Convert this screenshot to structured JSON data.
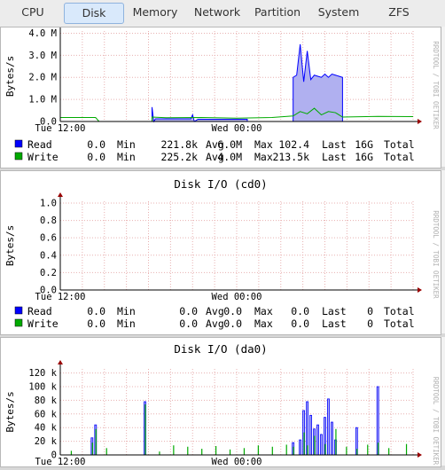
{
  "tabs": [
    {
      "label": "CPU",
      "active": false
    },
    {
      "label": "Disk",
      "active": true
    },
    {
      "label": "Memory",
      "active": false
    },
    {
      "label": "Network",
      "active": false
    },
    {
      "label": "Partition",
      "active": false
    },
    {
      "label": "System",
      "active": false
    },
    {
      "label": "ZFS",
      "active": false
    }
  ],
  "colors": {
    "read": "#0000ff",
    "read_fill": "#b0b0f0",
    "write": "#00aa00",
    "grid": "#e8b0b0",
    "axis": "#000000",
    "arrow": "#990000"
  },
  "watermark": "RRDTOOL / TOBI OETIKER",
  "charts": [
    {
      "title": "",
      "ylabel": "Bytes/s",
      "y_ticks": [
        {
          "v": 0,
          "label": "0.0"
        },
        {
          "v": 1000000,
          "label": "1.0 M"
        },
        {
          "v": 2000000,
          "label": "2.0 M"
        },
        {
          "v": 3000000,
          "label": "3.0 M"
        },
        {
          "v": 4000000,
          "label": "4.0 M"
        }
      ],
      "ymax": 4100000,
      "x_labels": [
        {
          "pos": 0.0,
          "label": "Tue 12:00"
        },
        {
          "pos": 0.5,
          "label": "Wed 00:00"
        }
      ],
      "legend": [
        {
          "name": "Read",
          "cur": "0.0",
          "min_label": "Min",
          "min": "221.8k",
          "avg_label": "Avg",
          "avg": "6.0M",
          "max_label": "Max",
          "max": "102.4",
          "last_label": "Last",
          "last": "16G",
          "total_label": "Total"
        },
        {
          "name": "Write",
          "cur": "0.0",
          "min_label": "Min",
          "min": "225.2k",
          "avg_label": "Avg",
          "avg": "4.0M",
          "max_label": "Max",
          "max": "213.5k",
          "last_label": "Last",
          "last": "16G",
          "total_label": "Total"
        }
      ]
    },
    {
      "title": "Disk I/O (cd0)",
      "ylabel": "Bytes/s",
      "y_ticks": [
        {
          "v": 0,
          "label": "0.0"
        },
        {
          "v": 0.2,
          "label": "0.2"
        },
        {
          "v": 0.4,
          "label": "0.4"
        },
        {
          "v": 0.6,
          "label": "0.6"
        },
        {
          "v": 0.8,
          "label": "0.8"
        },
        {
          "v": 1.0,
          "label": "1.0"
        }
      ],
      "ymax": 1.02,
      "x_labels": [
        {
          "pos": 0.0,
          "label": "Tue 12:00"
        },
        {
          "pos": 0.5,
          "label": "Wed 00:00"
        }
      ],
      "legend": [
        {
          "name": "Read",
          "cur": "0.0",
          "min_label": "Min",
          "min": "0.0",
          "avg_label": "Avg",
          "avg": "0.0",
          "max_label": "Max",
          "max": "0.0",
          "last_label": "Last",
          "last": "0",
          "total_label": "Total"
        },
        {
          "name": "Write",
          "cur": "0.0",
          "min_label": "Min",
          "min": "0.0",
          "avg_label": "Avg",
          "avg": "0.0",
          "max_label": "Max",
          "max": "0.0",
          "last_label": "Last",
          "last": "0",
          "total_label": "Total"
        }
      ]
    },
    {
      "title": "Disk I/O (da0)",
      "ylabel": "Bytes/s",
      "y_ticks": [
        {
          "v": 0,
          "label": "0"
        },
        {
          "v": 20000,
          "label": "20 k"
        },
        {
          "v": 40000,
          "label": "40 k"
        },
        {
          "v": 60000,
          "label": "60 k"
        },
        {
          "v": 80000,
          "label": "80 k"
        },
        {
          "v": 100000,
          "label": "100 k"
        },
        {
          "v": 120000,
          "label": "120 k"
        }
      ],
      "ymax": 126000,
      "x_labels": [
        {
          "pos": 0.0,
          "label": "Tue 12:00"
        },
        {
          "pos": 0.5,
          "label": "Wed 00:00"
        }
      ],
      "legend": []
    }
  ],
  "chart_data": [
    {
      "type": "area",
      "title": "",
      "ylabel": "Bytes/s",
      "ylim": [
        0,
        4100000
      ],
      "x_domain": [
        0,
        100
      ],
      "series": [
        {
          "name": "Read",
          "values": [
            [
              0,
              0
            ],
            [
              26,
              0
            ],
            [
              26,
              650000
            ],
            [
              26.5,
              0
            ],
            [
              27,
              120000
            ],
            [
              37,
              120000
            ],
            [
              37.5,
              300000
            ],
            [
              38,
              0
            ],
            [
              39,
              100000
            ],
            [
              53,
              100000
            ],
            [
              53,
              0
            ],
            [
              66,
              0
            ],
            [
              66,
              2000000
            ],
            [
              67,
              2100000
            ],
            [
              68,
              3500000
            ],
            [
              69,
              1800000
            ],
            [
              70,
              3200000
            ],
            [
              71,
              1900000
            ],
            [
              72,
              2100000
            ],
            [
              73,
              2050000
            ],
            [
              74,
              2000000
            ],
            [
              75,
              2150000
            ],
            [
              76,
              2000000
            ],
            [
              77,
              2150000
            ],
            [
              78,
              2100000
            ],
            [
              80,
              2000000
            ],
            [
              80,
              0
            ],
            [
              100,
              0
            ]
          ]
        },
        {
          "name": "Write",
          "values": [
            [
              0,
              180000
            ],
            [
              10,
              180000
            ],
            [
              11,
              0
            ],
            [
              26,
              0
            ],
            [
              26,
              200000
            ],
            [
              30,
              170000
            ],
            [
              40,
              180000
            ],
            [
              50,
              150000
            ],
            [
              60,
              180000
            ],
            [
              66,
              250000
            ],
            [
              68,
              450000
            ],
            [
              70,
              350000
            ],
            [
              72,
              600000
            ],
            [
              74,
              300000
            ],
            [
              76,
              450000
            ],
            [
              78,
              400000
            ],
            [
              80,
              200000
            ],
            [
              90,
              230000
            ],
            [
              100,
              220000
            ]
          ]
        }
      ]
    },
    {
      "type": "line",
      "title": "Disk I/O (cd0)",
      "ylabel": "Bytes/s",
      "ylim": [
        0,
        1
      ],
      "x_domain": [
        0,
        100
      ],
      "series": [
        {
          "name": "Read",
          "values": [
            [
              0,
              0
            ],
            [
              100,
              0
            ]
          ]
        },
        {
          "name": "Write",
          "values": [
            [
              0,
              0
            ],
            [
              100,
              0
            ]
          ]
        }
      ]
    },
    {
      "type": "bar",
      "title": "Disk I/O (da0)",
      "ylabel": "Bytes/s",
      "ylim": [
        0,
        120000
      ],
      "x_domain": [
        0,
        100
      ],
      "series": [
        {
          "name": "Read",
          "values": [
            [
              9,
              25000
            ],
            [
              10,
              44000
            ],
            [
              24,
              78000
            ],
            [
              66,
              18000
            ],
            [
              68,
              22000
            ],
            [
              69,
              65000
            ],
            [
              70,
              78000
            ],
            [
              71,
              58000
            ],
            [
              72,
              38000
            ],
            [
              73,
              44000
            ],
            [
              74,
              30000
            ],
            [
              75,
              55000
            ],
            [
              76,
              82000
            ],
            [
              77,
              48000
            ],
            [
              78,
              22000
            ],
            [
              84,
              40000
            ],
            [
              90,
              100000
            ]
          ]
        },
        {
          "name": "Write",
          "values": [
            [
              3,
              6000
            ],
            [
              9,
              18000
            ],
            [
              10,
              38000
            ],
            [
              13,
              10000
            ],
            [
              24,
              74000
            ],
            [
              28,
              5000
            ],
            [
              32,
              14000
            ],
            [
              36,
              12000
            ],
            [
              40,
              9000
            ],
            [
              44,
              13000
            ],
            [
              48,
              8000
            ],
            [
              52,
              10000
            ],
            [
              56,
              14000
            ],
            [
              60,
              12000
            ],
            [
              64,
              15000
            ],
            [
              66,
              12000
            ],
            [
              69,
              33000
            ],
            [
              70,
              14000
            ],
            [
              72,
              28000
            ],
            [
              75,
              16000
            ],
            [
              78,
              38000
            ],
            [
              81,
              12000
            ],
            [
              84,
              9000
            ],
            [
              87,
              15000
            ],
            [
              90,
              18000
            ],
            [
              93,
              10000
            ],
            [
              98,
              16000
            ]
          ]
        }
      ]
    }
  ]
}
